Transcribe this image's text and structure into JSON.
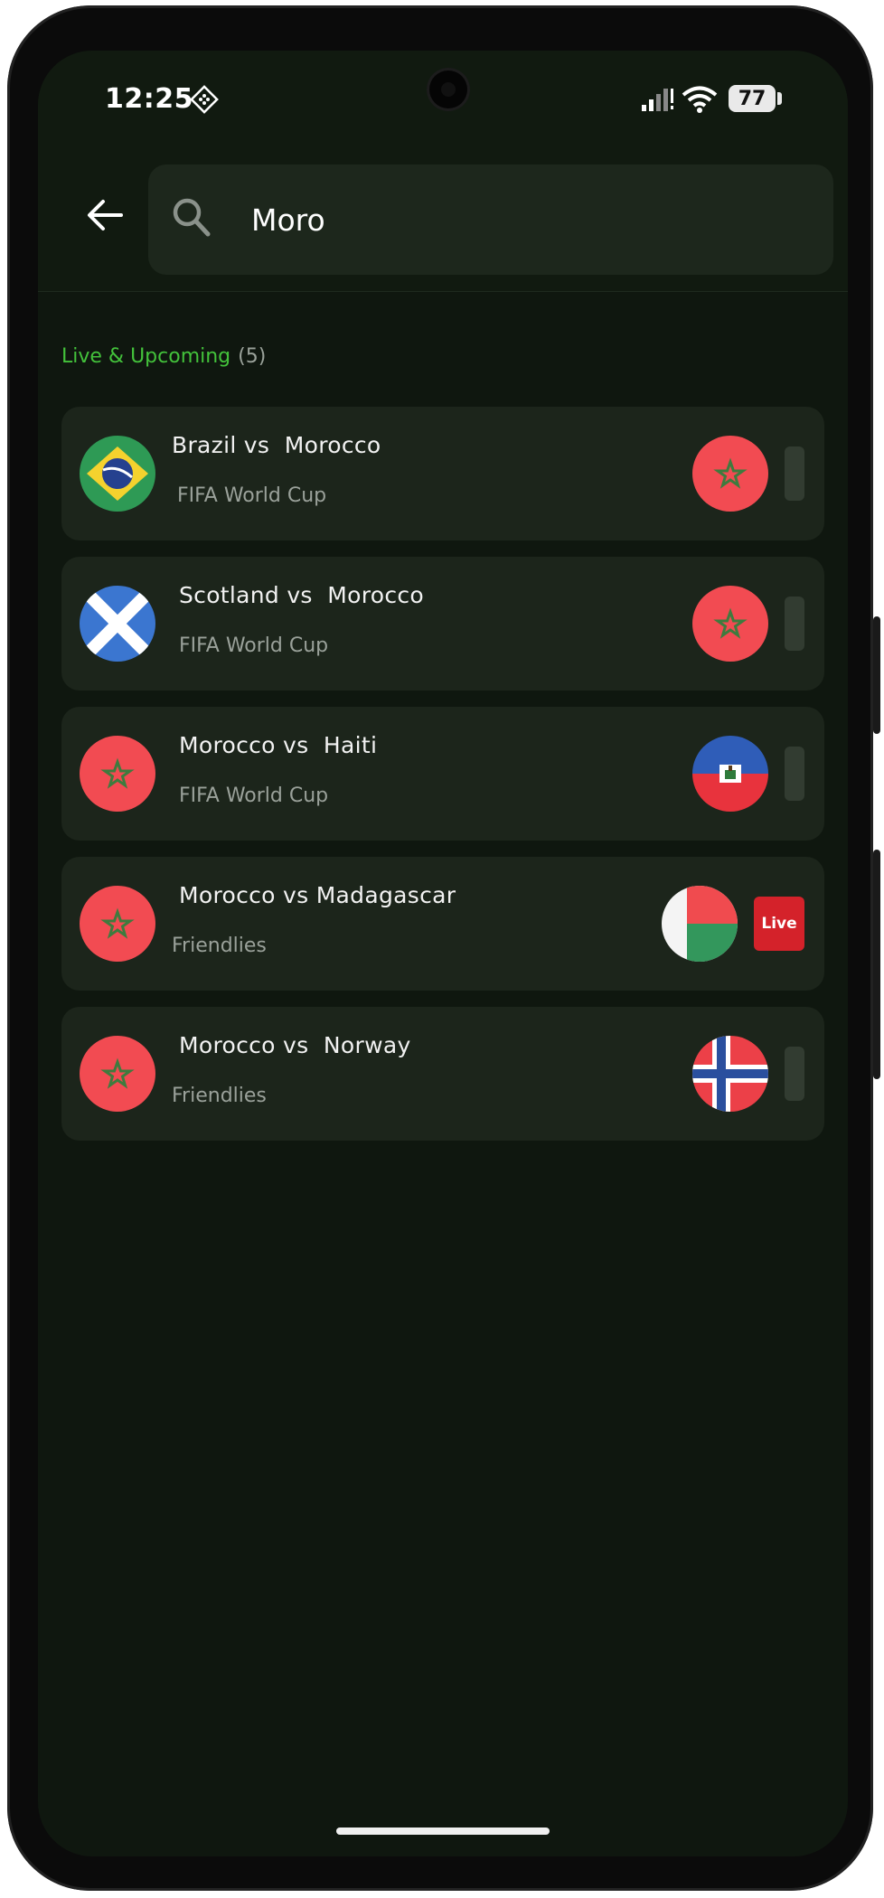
{
  "status_bar": {
    "time": "12:25",
    "battery": "77"
  },
  "search": {
    "value": "Moro",
    "placeholder": ""
  },
  "section": {
    "title": "Live & Upcoming",
    "count": "(5)"
  },
  "matches": [
    {
      "title": "Brazil vs  Morocco",
      "competition": "FIFA World Cup",
      "home_flag": "brazil-flag-icon",
      "away_flag": "morocco-flag-icon",
      "live": false
    },
    {
      "title": "Scotland vs  Morocco",
      "competition": "FIFA World Cup",
      "home_flag": "scotland-flag-icon",
      "away_flag": "morocco-flag-icon",
      "live": false
    },
    {
      "title": "Morocco vs  Haiti",
      "competition": "FIFA World Cup",
      "home_flag": "morocco-flag-icon",
      "away_flag": "haiti-flag-icon",
      "live": false
    },
    {
      "title": "Morocco vs Madagascar",
      "competition": "Friendlies",
      "home_flag": "morocco-flag-icon",
      "away_flag": "madagascar-flag-icon",
      "live": true,
      "live_label": "Live"
    },
    {
      "title": "Morocco vs  Norway",
      "competition": "Friendlies",
      "home_flag": "morocco-flag-icon",
      "away_flag": "norway-flag-icon",
      "live": false
    }
  ],
  "colors": {
    "accent": "#43c23b",
    "background": "#0f170f",
    "card": "#1c251b",
    "live": "#d4222a"
  }
}
